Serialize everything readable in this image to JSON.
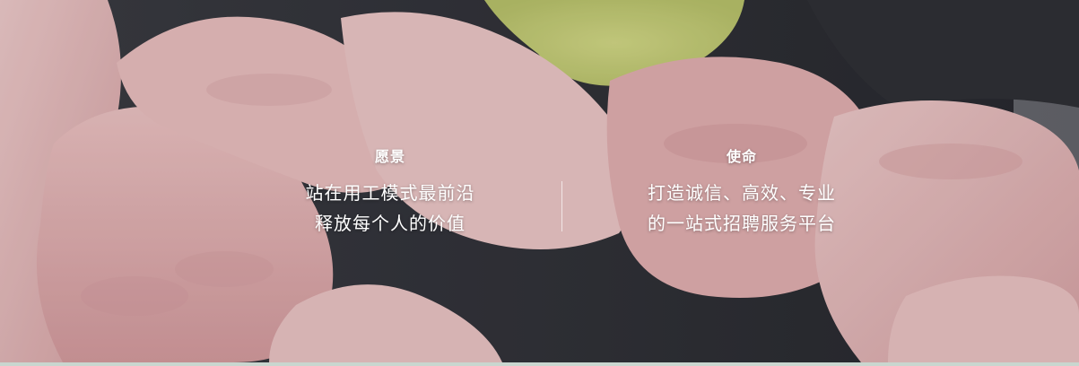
{
  "colors": {
    "overlay_text": "#ffffff",
    "background_dark": "#2a2b31",
    "skin_tone": "#e8bcbc",
    "green_accent": "#c9d07a"
  },
  "vision": {
    "heading": "愿景",
    "line1": "站在用工模式最前沿",
    "line2": "释放每个人的价值"
  },
  "mission": {
    "heading": "使命",
    "line1": "打造诚信、高效、专业",
    "line2": "的一站式招聘服务平台"
  }
}
